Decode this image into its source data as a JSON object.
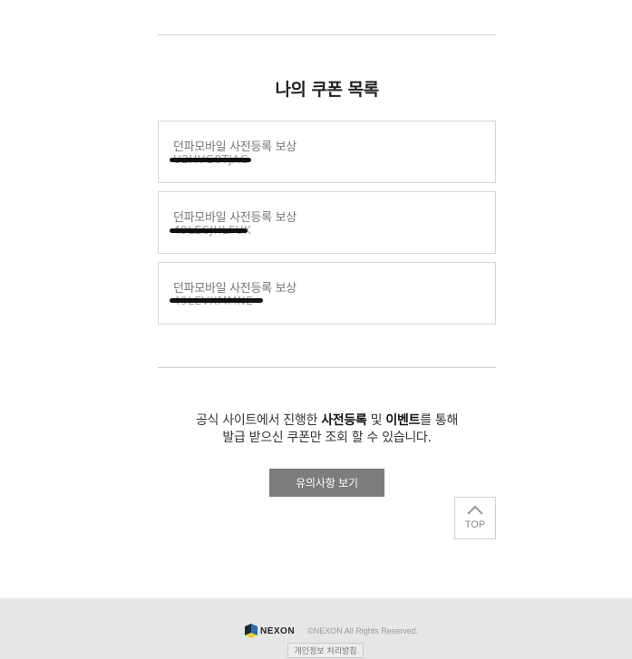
{
  "page": {
    "title": "나의 쿠폰 목록"
  },
  "coupons": [
    {
      "title": "던파모바일 사전등록 보상",
      "code": "U2HVG0TJAG"
    },
    {
      "title": "던파모바일 사전등록 보상",
      "code": "49LECJHLFUK"
    },
    {
      "title": "던파모바일 사전등록 보상",
      "code": "49LEVXMMNE"
    }
  ],
  "notice": {
    "line1_pre": "공식 사이트에서 진행한 ",
    "line1_bold1": "사전등록",
    "line1_mid": " 및 ",
    "line1_bold2": "이벤트",
    "line1_post": "를 통해",
    "line2": "발급 받으신 쿠폰만 조회 할 수 있습니다.",
    "button_label": "유의사항 보기"
  },
  "top_button": {
    "label": "TOP",
    "icon": "chevron-up-icon"
  },
  "footer": {
    "brand": "NEXON",
    "copyright": "©NEXON All Rights Reserved.",
    "privacy_link": "개인정보 처리방침"
  },
  "colors": {
    "button_bg": "#7c7c7c",
    "footer_bg": "#e6e6e6",
    "border": "#d6d6d6",
    "redaction": "#111111"
  }
}
